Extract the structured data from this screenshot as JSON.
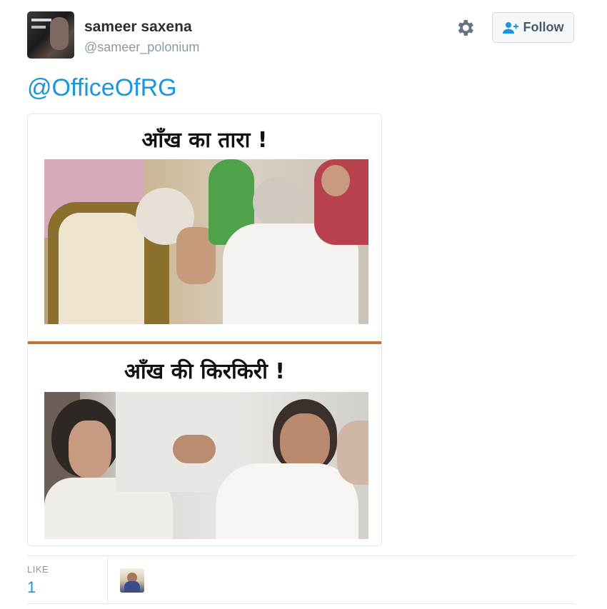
{
  "tweet": {
    "author": {
      "display_name": "sameer saxena",
      "handle": "@sameer_polonium",
      "avatar_icon": "user-avatar"
    },
    "actions": {
      "settings_icon": "gear-icon",
      "follow_label": "Follow"
    },
    "text": "@OfficeOfRG",
    "media": {
      "caption_top": "आँख का तारा !",
      "caption_bottom": "आँख की किरकिरी !",
      "divider_color": "#c8703a"
    },
    "stats": {
      "like_label": "LIKE",
      "like_count": "1"
    }
  },
  "colors": {
    "link_blue": "#1b95e0",
    "muted_gray": "#8899a6",
    "border_gray": "#e1e8ed",
    "text_dark": "#292f33"
  }
}
